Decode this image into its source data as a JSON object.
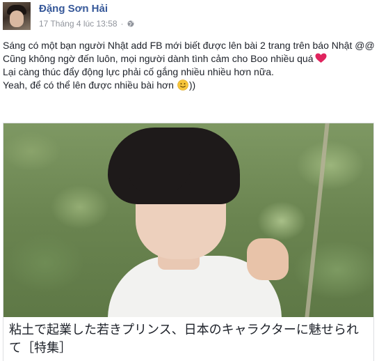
{
  "post": {
    "author": "Đặng Sơn Hải",
    "timestamp": "17 Tháng 4 lúc 13:58",
    "separator": "·",
    "privacy_icon": "globe-icon",
    "lines": [
      "Sáng có một bạn người Nhật add FB mới biết được lên bài 2 trang trên báo Nhật @@",
      "Cũng không ngờ đến luôn, mọi người dành tình cảm cho Boo nhiều quá",
      "Lại càng thúc đẩy động lực phải cố gắng nhiều nhiều hơn nữa.",
      "Yeah, để có thể lên được nhiều bài hơn",
      "))"
    ],
    "emoji": {
      "heart": "heart-icon",
      "smile": "smile-icon"
    },
    "colors": {
      "author": "#365899",
      "meta": "#90949c",
      "text": "#1d2129",
      "heart": "#e0245e",
      "smile": "#f7c53a"
    }
  },
  "attachment": {
    "caption": "粘土で起業した若きプリンス、日本のキャラクターに魅せられて［特集］"
  }
}
